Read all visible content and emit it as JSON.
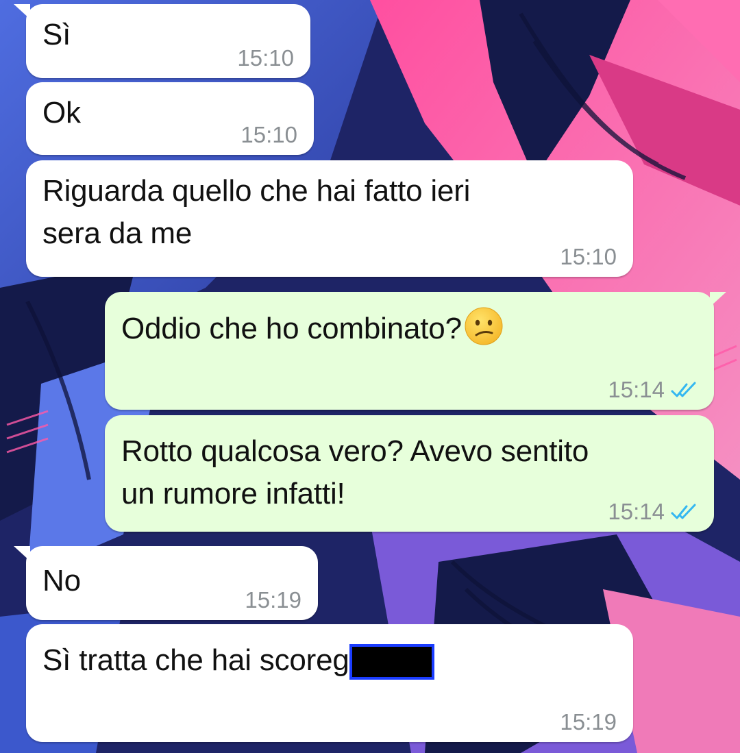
{
  "messages": [
    {
      "direction": "incoming",
      "text": "Sì",
      "time": "15:10"
    },
    {
      "direction": "incoming",
      "text": "Ok",
      "time": "15:10"
    },
    {
      "direction": "incoming",
      "lines": [
        "Riguarda quello che hai fatto ieri",
        "sera da me"
      ],
      "time": "15:10"
    },
    {
      "direction": "outgoing",
      "text": "Oddio che ho combinato?",
      "emoji": "confused-face",
      "time": "15:14",
      "status": "read"
    },
    {
      "direction": "outgoing",
      "lines": [
        "Rotto qualcosa vero? Avevo sentito",
        "un rumore infatti!"
      ],
      "time": "15:14",
      "status": "read"
    },
    {
      "direction": "incoming",
      "text": "No",
      "time": "15:19"
    },
    {
      "direction": "incoming",
      "text": "Sì tratta che hai scoreg",
      "redacted": true,
      "time": "15:19"
    }
  ],
  "colors": {
    "incoming_bubble": "#ffffff",
    "outgoing_bubble": "#e7ffdb",
    "timestamp": "#8a8f93",
    "read_ticks": "#34b7f1",
    "redaction_border": "#1a3cff"
  }
}
